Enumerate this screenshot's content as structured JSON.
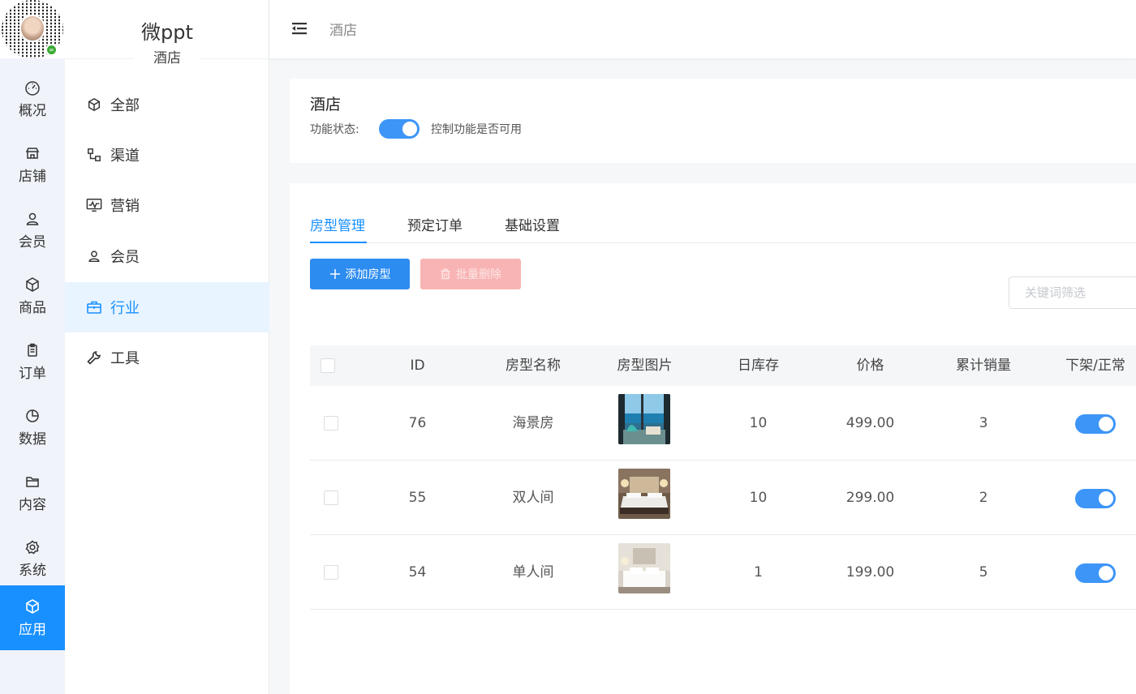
{
  "app": {
    "brand_name": "微ppt",
    "brand_sub": "酒店"
  },
  "rail": {
    "items": [
      {
        "label": "概况",
        "icon": "dashboard-icon"
      },
      {
        "label": "店铺",
        "icon": "store-icon"
      },
      {
        "label": "会员",
        "icon": "user-icon"
      },
      {
        "label": "商品",
        "icon": "box-icon"
      },
      {
        "label": "订单",
        "icon": "clipboard-icon"
      },
      {
        "label": "数据",
        "icon": "pie-chart-icon"
      },
      {
        "label": "内容",
        "icon": "folder-icon"
      },
      {
        "label": "系统",
        "icon": "gear-icon"
      },
      {
        "label": "应用",
        "icon": "cube-icon",
        "active": true
      }
    ],
    "active_color": "#1890ff"
  },
  "submenu": {
    "items": [
      {
        "label": "全部",
        "icon": "cube-icon"
      },
      {
        "label": "渠道",
        "icon": "channel-icon"
      },
      {
        "label": "营销",
        "icon": "monitor-chart-icon"
      },
      {
        "label": "会员",
        "icon": "user-icon"
      },
      {
        "label": "行业",
        "icon": "briefcase-icon",
        "active": true
      },
      {
        "label": "工具",
        "icon": "wrench-icon"
      }
    ]
  },
  "header": {
    "breadcrumb": "酒店"
  },
  "feature": {
    "title": "酒店",
    "status_label": "功能状态:",
    "enabled": true,
    "description": "控制功能是否可用"
  },
  "tabs": [
    {
      "label": "房型管理",
      "active": true
    },
    {
      "label": "预定订单"
    },
    {
      "label": "基础设置"
    }
  ],
  "toolbar": {
    "add_label": "添加房型",
    "delete_label": "批量删除",
    "search_placeholder": "关键词筛选"
  },
  "table": {
    "columns": [
      "ID",
      "房型名称",
      "房型图片",
      "日库存",
      "价格",
      "累计销量",
      "下架/正常"
    ],
    "rows": [
      {
        "id": "76",
        "name": "海景房",
        "image": "sea-view-room-thumbnail",
        "stock": "10",
        "price": "499.00",
        "sales": "3",
        "on_sale": true
      },
      {
        "id": "55",
        "name": "双人间",
        "image": "twin-room-thumbnail",
        "stock": "10",
        "price": "299.00",
        "sales": "2",
        "on_sale": true
      },
      {
        "id": "54",
        "name": "单人间",
        "image": "single-room-thumbnail",
        "stock": "1",
        "price": "199.00",
        "sales": "5",
        "on_sale": true
      }
    ]
  },
  "colors": {
    "primary": "#1890ff",
    "switch_on": "#3d95f7",
    "danger_disabled": "#f8b4b4"
  }
}
